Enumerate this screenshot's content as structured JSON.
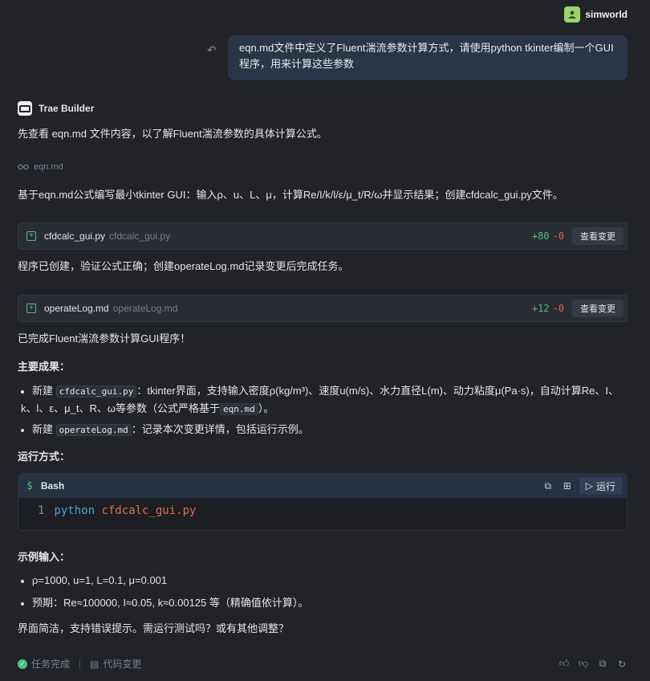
{
  "user": {
    "name": "simworld"
  },
  "user_message": "eqn.md文件中定义了Fluent湍流参数计算方式，请使用python tkinter编制一个GUI程序，用来计算这些参数",
  "assistant": {
    "name": "Trae Builder"
  },
  "messages": {
    "intro": "先查看 eqn.md 文件内容，以了解Fluent湍流参数的具体计算公式。",
    "file_ref": "eqn.md",
    "plan": "基于eqn.md公式编写最小tkinter GUI：输入ρ、u、L、μ，计算Re/I/k/l/ε/μ_t/R/ω并显示结果；创建cfdcalc_gui.py文件。",
    "created": "程序已创建，验证公式正确；创建operateLog.md记录变更后完成任务。",
    "done": "已完成Fluent湍流参数计算GUI程序！",
    "achievements_heading": "主要成果：",
    "run_heading": "运行方式：",
    "example_heading": "示例输入：",
    "closing": "界面简洁，支持错误提示。需运行测试吗？或有其他调整？"
  },
  "files": [
    {
      "name": "cfdcalc_gui.py",
      "path": "cfdcalc_gui.py",
      "added": "+80",
      "removed": "-0",
      "button": "查看变更"
    },
    {
      "name": "operateLog.md",
      "path": "operateLog.md",
      "added": "+12",
      "removed": "-0",
      "button": "查看变更"
    }
  ],
  "achievements": [
    {
      "prefix": "新建",
      "code": "cfdcalc_gui.py",
      "text": "：tkinter界面，支持输入密度ρ(kg/m³)、速度u(m/s)、水力直径L(m)、动力粘度μ(Pa·s)，自动计算Re、I、k、l、ε、μ_t、R、ω等参数（公式严格基于",
      "code2": "eqn.md",
      "suffix": "）。"
    },
    {
      "prefix": "新建",
      "code": "operateLog.md",
      "text": "：记录本次变更详情，包括运行示例。"
    }
  ],
  "code_block": {
    "language": "Bash",
    "run_label": "运行",
    "line_number": "1",
    "command": "python",
    "argument": "cfdcalc_gui.py"
  },
  "examples": [
    "ρ=1000, u=1, L=0.1, μ=0.001",
    "预期：Re≈100000, I≈0.05, k≈0.00125 等（精确值依计算）。"
  ],
  "footer": {
    "status": "任务完成",
    "changes": "代码变更"
  }
}
